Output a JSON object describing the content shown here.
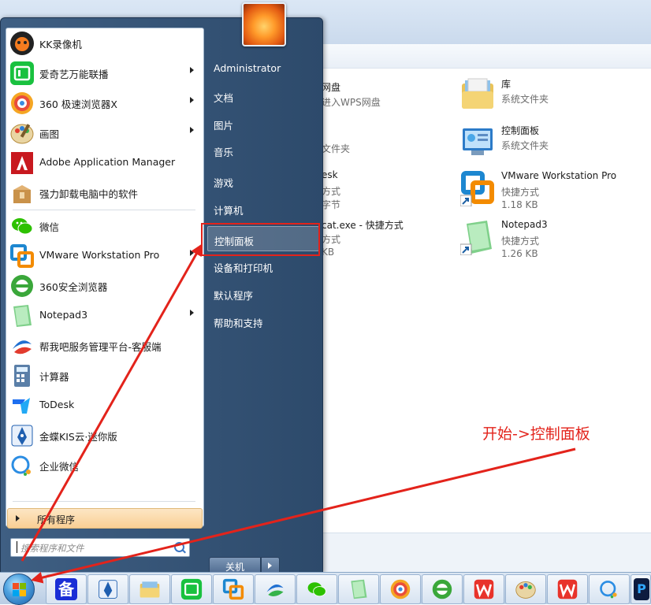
{
  "start_menu": {
    "programs": [
      {
        "label": "KK录像机",
        "icon": "kk-recorder-icon",
        "color": "#1a1a1a",
        "submenu": false
      },
      {
        "label": "爱奇艺万能联播",
        "icon": "iqiyi-cast-icon",
        "color": "#19c13f",
        "submenu": true
      },
      {
        "label": "360 极速浏览器X",
        "icon": "360-speed-browser-icon",
        "color": "#f5a623",
        "submenu": true
      },
      {
        "label": "画图",
        "icon": "paint-icon",
        "color": "#d9a441",
        "submenu": true
      },
      {
        "label": "Adobe Application Manager",
        "icon": "adobe-icon",
        "color": "#c8191f",
        "submenu": false
      },
      {
        "label": "强力卸载电脑中的软件",
        "icon": "uninstall-box-icon",
        "color": "#c9924a",
        "submenu": false
      },
      {
        "label": "微信",
        "icon": "wechat-icon",
        "color": "#2dc100",
        "submenu": false
      },
      {
        "label": "VMware Workstation Pro",
        "icon": "vmware-icon",
        "color": "#1d87d0",
        "submenu": true
      },
      {
        "label": "360安全浏览器",
        "icon": "360-safe-browser-icon",
        "color": "#3aa73a",
        "submenu": false
      },
      {
        "label": "Notepad3",
        "icon": "notepad3-icon",
        "color": "#59b66a",
        "submenu": true
      },
      {
        "label": "帮我吧服务管理平台-客服端",
        "icon": "bangwoba-icon",
        "color": "#1f6fd1",
        "submenu": false
      },
      {
        "label": "计算器",
        "icon": "calculator-icon",
        "color": "#5a7fa8",
        "submenu": false
      },
      {
        "label": "ToDesk",
        "icon": "todesk-icon",
        "color": "#1e6ff0",
        "submenu": false
      },
      {
        "label": "金蝶KIS云·迷你版",
        "icon": "kingdee-icon",
        "color": "#1f5fb0",
        "submenu": false
      },
      {
        "label": "企业微信",
        "icon": "wecom-icon",
        "color": "#2b8de3",
        "submenu": false
      }
    ],
    "all_programs_label": "所有程序",
    "search_placeholder": "搜索程序和文件",
    "user_name": "Administrator",
    "right_items": [
      "文档",
      "图片",
      "音乐",
      "游戏",
      "计算机",
      "控制面板",
      "设备和打印机",
      "默认程序",
      "帮助和支持"
    ],
    "highlighted_item": "控制面板",
    "shutdown_label": "关机"
  },
  "explorer": {
    "tiles": [
      {
        "name": "库",
        "type": "系统文件夹",
        "size": "",
        "icon": "library-folder-icon"
      },
      {
        "name": "控制面板",
        "type": "系统文件夹",
        "size": "",
        "icon": "control-panel-icon"
      },
      {
        "name": "VMware Workstation Pro",
        "type": "快捷方式",
        "size": "1.18 KB",
        "icon": "vmware-shortcut-icon"
      },
      {
        "name": "Notepad3",
        "type": "快捷方式",
        "size": "1.26 KB",
        "icon": "notepad3-shortcut-icon"
      }
    ],
    "partial_texts": [
      "网盘",
      "进入WPS网盘",
      "文件夹",
      "esk",
      "方式",
      "字节",
      "cat.exe - 快捷方式",
      "方式",
      "KB"
    ]
  },
  "annotation": "开始->控制面板",
  "annotation_color": "#e3231b",
  "taskbar": {
    "icons": [
      "bei-icon",
      "kingdee-icon",
      "file-explorer-icon",
      "iqiyi-cast-icon",
      "vmware-icon",
      "bangwoba-icon",
      "wechat-icon",
      "notepad3-icon",
      "360-speed-browser-icon",
      "360-safe-browser-icon",
      "wps-icon",
      "paint-icon",
      "wps-icon",
      "wecom-icon",
      "photoshop-icon"
    ],
    "bei_label": "备",
    "ps_label": "P"
  }
}
